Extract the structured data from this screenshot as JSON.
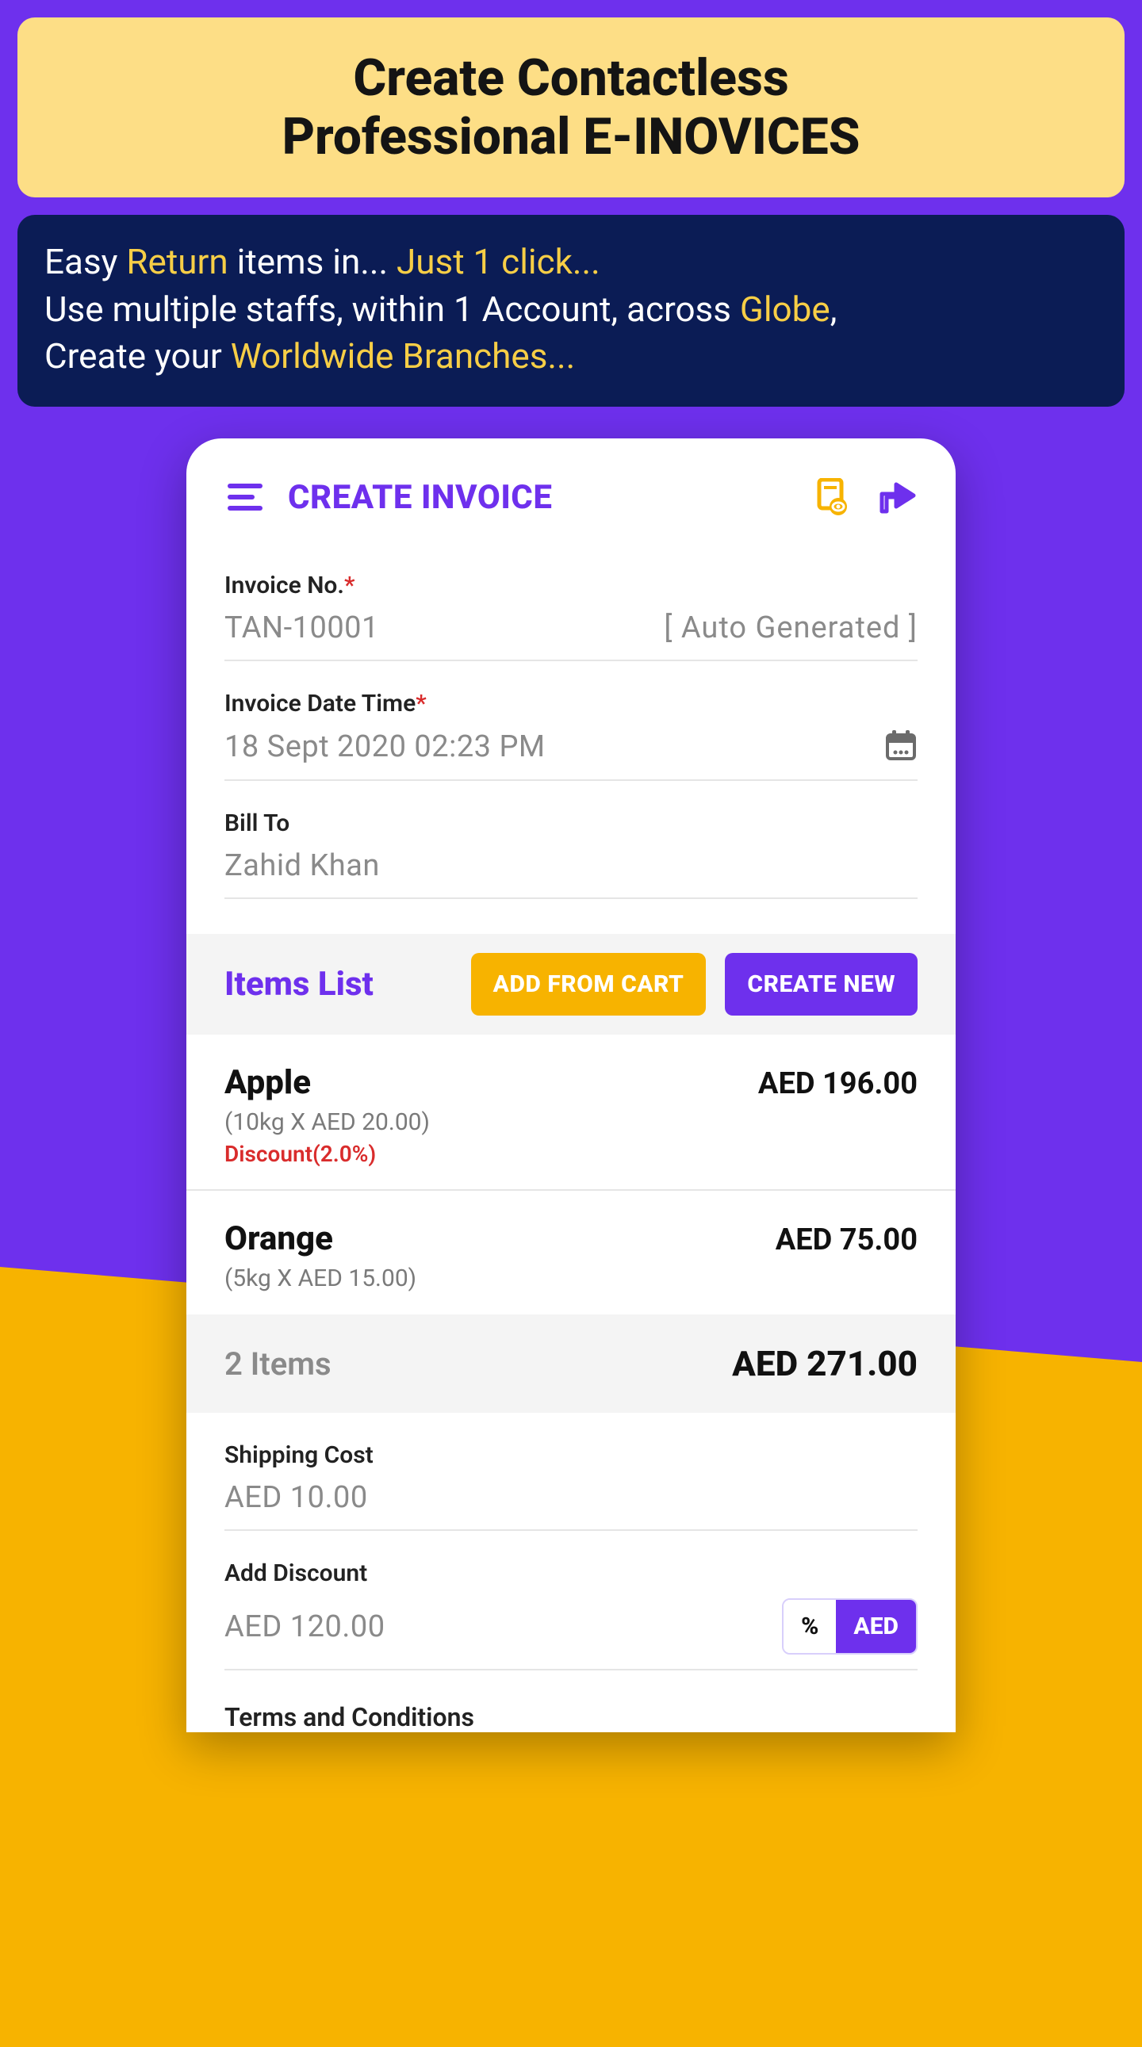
{
  "promo": {
    "yellow_line1": "Create Contactless",
    "yellow_line2": "Professional E-INOVICES",
    "blue_parts": {
      "p1": "Easy ",
      "p2": "Return",
      "p3": " items in... ",
      "p4": "Just 1 click...",
      "p5": "Use multiple staffs, within 1 Account, across ",
      "p6": "Globe",
      "p7": ",",
      "p8": "Create your ",
      "p9": "Worldwide Branches..."
    }
  },
  "header": {
    "title": "CREATE INVOICE"
  },
  "fields": {
    "invoice_no": {
      "label": "Invoice No.",
      "value": "TAN-10001",
      "note": "[ Auto Generated ]"
    },
    "invoice_dt": {
      "label": "Invoice Date Time",
      "value": "18 Sept 2020 02:23 PM"
    },
    "bill_to": {
      "label": "Bill To",
      "value": "Zahid Khan"
    },
    "shipping": {
      "label": "Shipping Cost",
      "value": "AED 10.00"
    },
    "discount": {
      "label": "Add Discount",
      "value": "AED 120.00",
      "seg_pct": "%",
      "seg_cur": "AED"
    },
    "terms": {
      "label": "Terms and Conditions"
    }
  },
  "items_bar": {
    "title": "Items List",
    "add_from_cart": "ADD FROM CART",
    "create_new": "CREATE NEW"
  },
  "items": [
    {
      "name": "Apple",
      "price": "AED 196.00",
      "sub": "(10kg X AED 20.00)",
      "discount": "Discount(2.0%)"
    },
    {
      "name": "Orange",
      "price": "AED 75.00",
      "sub": "(5kg X AED 15.00)"
    }
  ],
  "totals": {
    "count": "2 Items",
    "sum": "AED 271.00"
  }
}
